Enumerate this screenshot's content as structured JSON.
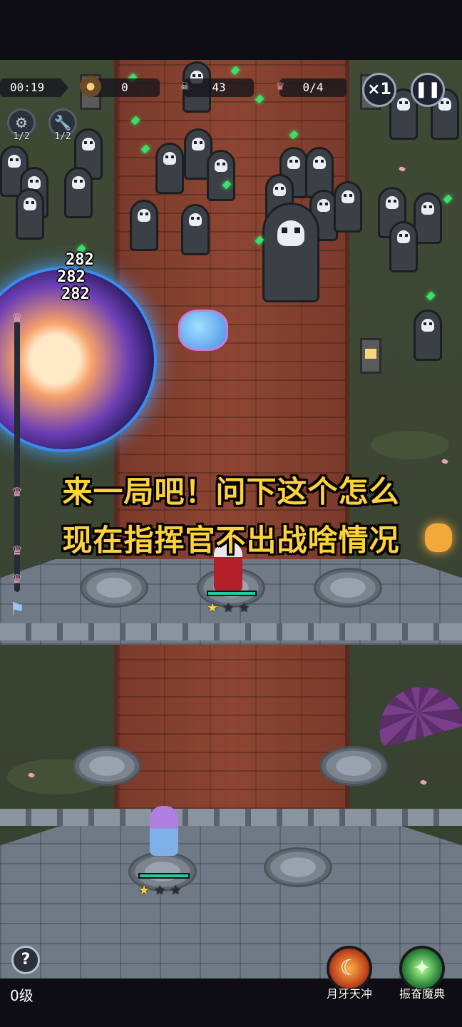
{
  "hud": {
    "timer": "00:19",
    "gold_icon": "coin-bag-icon",
    "gold": "0",
    "kills_icon": "skull-icon",
    "kills": "43",
    "boss_icon": "demon-head-icon",
    "boss_progress": "0/4",
    "speed_label": "×1",
    "pause_icon": "pause-icon"
  },
  "mini_skills": [
    {
      "icon": "gear-icon",
      "glyph": "⚙",
      "count": "1/2"
    },
    {
      "icon": "wrench-icon",
      "glyph": "🔧",
      "count": "1/2"
    }
  ],
  "damage_numbers": [
    "282",
    "282",
    "282"
  ],
  "caption": {
    "line1": "来一局吧！问下这个怎么",
    "line2": "现在指挥官不出战啥情况"
  },
  "heroes": [
    {
      "name": "red-swordsman",
      "stars_filled": 1,
      "stars_total": 3,
      "hp_fraction": 1.0
    },
    {
      "name": "purple-mage-girl",
      "stars_filled": 1,
      "stars_total": 3,
      "hp_fraction": 1.0
    }
  ],
  "bottom": {
    "help_glyph": "?",
    "level": "0级",
    "skill1_label": "月牙天冲",
    "skill2_label": "振奋魔典"
  },
  "colors": {
    "caption": "#ffd23a",
    "hp_fill": "#27c7a0",
    "gem": "#39e06a",
    "road": "#8c4532"
  }
}
